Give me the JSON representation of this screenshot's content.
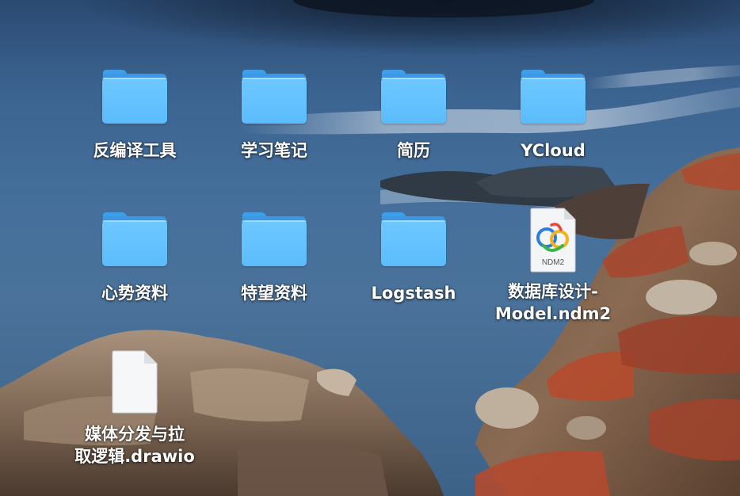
{
  "desktop": {
    "items": [
      {
        "label": "反编译工具",
        "kind": "folder",
        "icon": "folder-icon"
      },
      {
        "label": "学习笔记",
        "kind": "folder",
        "icon": "folder-icon"
      },
      {
        "label": "简历",
        "kind": "folder",
        "icon": "folder-icon"
      },
      {
        "label": "YCloud",
        "kind": "folder",
        "icon": "folder-icon"
      },
      {
        "label": "心势资料",
        "kind": "folder",
        "icon": "folder-icon"
      },
      {
        "label": "特望资料",
        "kind": "folder",
        "icon": "folder-icon"
      },
      {
        "label": "Logstash",
        "kind": "folder",
        "icon": "folder-icon"
      },
      {
        "label_line1": "数据库设计-",
        "label_line2": "Model.ndm2",
        "badge": "NDM2",
        "kind": "document",
        "icon": "navicat-data-modeler-file-icon"
      },
      {
        "label_line1": "媒体分发与拉",
        "label_line2": "取逻辑.drawio",
        "kind": "document",
        "icon": "blank-document-icon"
      }
    ]
  },
  "colors": {
    "folder_front": "#5bbcfb",
    "folder_back": "#3a98e4",
    "label_text": "#ffffff"
  }
}
